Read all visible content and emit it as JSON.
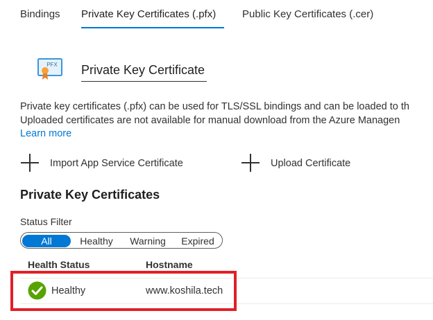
{
  "tabs": {
    "bindings": "Bindings",
    "private": "Private Key Certificates (.pfx)",
    "public": "Public Key Certificates (.cer)"
  },
  "hero": {
    "icon_text": "PFX",
    "title": "Private Key Certificate"
  },
  "description": {
    "line1": "Private key certificates (.pfx) can be used for TLS/SSL bindings and can be loaded to th",
    "line2": "Uploaded certificates are not available for manual download from the Azure Managen",
    "learn_more": "Learn more"
  },
  "actions": {
    "import": "Import App Service Certificate",
    "upload": "Upload Certificate"
  },
  "section": {
    "title": "Private Key Certificates",
    "status_filter_label": "Status Filter"
  },
  "filter": {
    "options": [
      "All",
      "Healthy",
      "Warning",
      "Expired"
    ],
    "selected": "All"
  },
  "table": {
    "headers": [
      "Health Status",
      "Hostname"
    ],
    "rows": [
      {
        "status": "Healthy",
        "hostname": "www.koshila.tech"
      }
    ]
  },
  "colors": {
    "accent": "#0078d4",
    "healthy": "#57a300",
    "highlight": "#e02027"
  }
}
